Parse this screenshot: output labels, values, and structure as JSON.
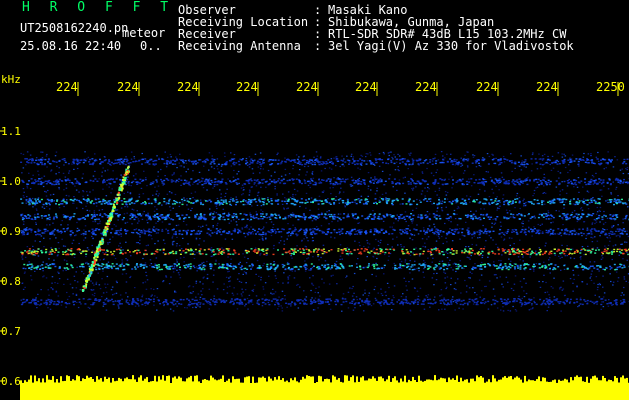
{
  "header": {
    "title": "H R O F F T",
    "filename": "UT2508162240.pn",
    "meteor_label": "meteor",
    "datetime": "25.08.16 22:40",
    "count": "0..",
    "fields": [
      {
        "label": "Observer",
        "value": "Masaki Kano"
      },
      {
        "label": "Receiving Location",
        "value": "Shibukawa, Gunma, Japan"
      },
      {
        "label": "Receiver",
        "value": "RTL-SDR SDR# 43dB L15 103.2MHz CW"
      },
      {
        "label": "Receiving Antenna",
        "value": "3el Yagi(V) Az 330 for Vladivostok"
      }
    ]
  },
  "colors": {
    "background": "#000000",
    "axis_text": "#ffff00",
    "title": "#00ff66",
    "header_text": "#ffffff"
  },
  "chart_data": {
    "type": "heatmap",
    "ylabel": "kHz",
    "ylim": [
      0.6,
      1.15
    ],
    "y_ticks": [
      "1.1",
      "1.0",
      "0.9",
      "0.8",
      "0.7",
      "0.6"
    ],
    "y_tick_values": [
      1.1,
      1.0,
      0.9,
      0.8,
      0.7,
      0.6
    ],
    "x_ticks": [
      "224",
      "224",
      "224",
      "224",
      "224",
      "224",
      "224",
      "224",
      "224",
      "2250"
    ],
    "bands": [
      {
        "freq": 0.96,
        "intensity": 0.55
      },
      {
        "freq": 0.93,
        "intensity": 0.45
      },
      {
        "freq": 0.9,
        "intensity": 0.35
      },
      {
        "freq": 0.86,
        "intensity": 0.95
      },
      {
        "freq": 0.83,
        "intensity": 0.6
      },
      {
        "freq": 1.04,
        "intensity": 0.3
      },
      {
        "freq": 1.0,
        "intensity": 0.3
      },
      {
        "freq": 0.76,
        "intensity": 0.25
      }
    ],
    "meteor_trail": {
      "freq_start": 0.78,
      "freq_end": 1.03
    }
  }
}
